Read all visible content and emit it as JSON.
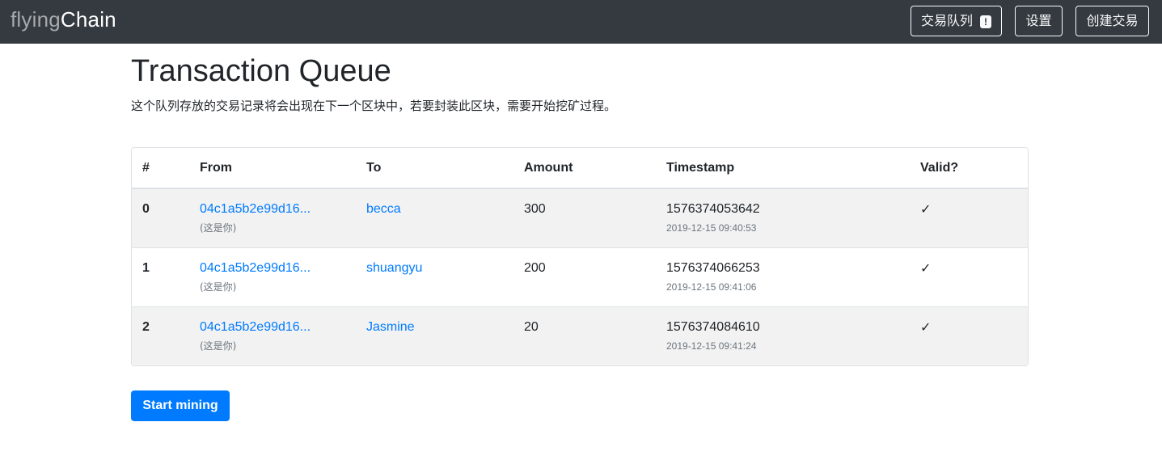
{
  "navbar": {
    "brand_part1": "flying",
    "brand_part2": "Chain",
    "queue_label": "交易队列",
    "queue_badge": "!",
    "settings_label": "设置",
    "create_label": "创建交易"
  },
  "main": {
    "title": "Transaction Queue",
    "lead": "这个队列存放的交易记录将会出现在下一个区块中，若要封装此区块，需要开始挖矿过程。",
    "mine_button": "Start mining"
  },
  "table": {
    "headers": [
      "#",
      "From",
      "To",
      "Amount",
      "Timestamp",
      "Valid?"
    ],
    "rows": [
      {
        "index": "0",
        "from": "04c1a5b2e99d16...",
        "from_note": "(这是你)",
        "to": "becca",
        "amount": "300",
        "timestamp": "1576374053642",
        "datetime": "2019-12-15 09:40:53",
        "valid": "✓"
      },
      {
        "index": "1",
        "from": "04c1a5b2e99d16...",
        "from_note": "(这是你)",
        "to": "shuangyu",
        "amount": "200",
        "timestamp": "1576374066253",
        "datetime": "2019-12-15 09:41:06",
        "valid": "✓"
      },
      {
        "index": "2",
        "from": "04c1a5b2e99d16...",
        "from_note": "(这是你)",
        "to": "Jasmine",
        "amount": "20",
        "timestamp": "1576374084610",
        "datetime": "2019-12-15 09:41:24",
        "valid": "✓"
      }
    ]
  },
  "colors": {
    "navbar_bg": "#343a40",
    "link": "#007bff",
    "primary_button": "#007bff",
    "stripe": "#f2f2f2"
  }
}
